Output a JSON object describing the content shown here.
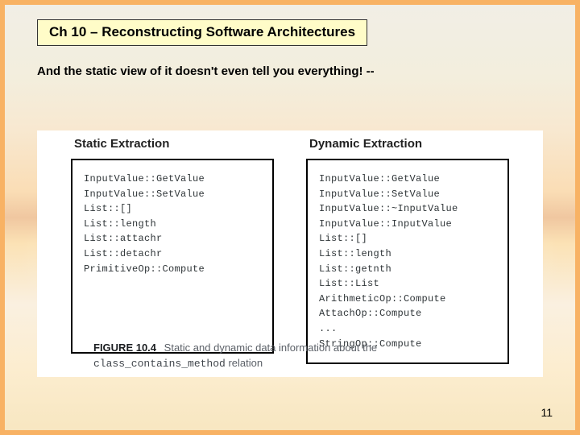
{
  "header": {
    "title": "Ch 10 – Reconstructing Software Architectures"
  },
  "subtitle": "And the static view of it doesn't even tell you everything! --",
  "figure": {
    "static": {
      "heading": "Static Extraction",
      "lines": [
        "InputValue::GetValue",
        "InputValue::SetValue",
        "List::[]",
        "List::length",
        "List::attachr",
        "List::detachr",
        "PrimitiveOp::Compute"
      ]
    },
    "dynamic": {
      "heading": "Dynamic Extraction",
      "lines": [
        "InputValue::GetValue",
        "InputValue::SetValue",
        "InputValue::~InputValue",
        "InputValue::InputValue",
        "List::[]",
        "List::length",
        "List::getnth",
        "List::List",
        "ArithmeticOp::Compute",
        "AttachOp::Compute",
        "...",
        "StringOp::Compute"
      ]
    },
    "caption": {
      "figno": "FIGURE 10.4",
      "text_a": "Static and dynamic data information about the",
      "relation": "class_contains_method",
      "text_b": "relation"
    }
  },
  "page_number": "11"
}
